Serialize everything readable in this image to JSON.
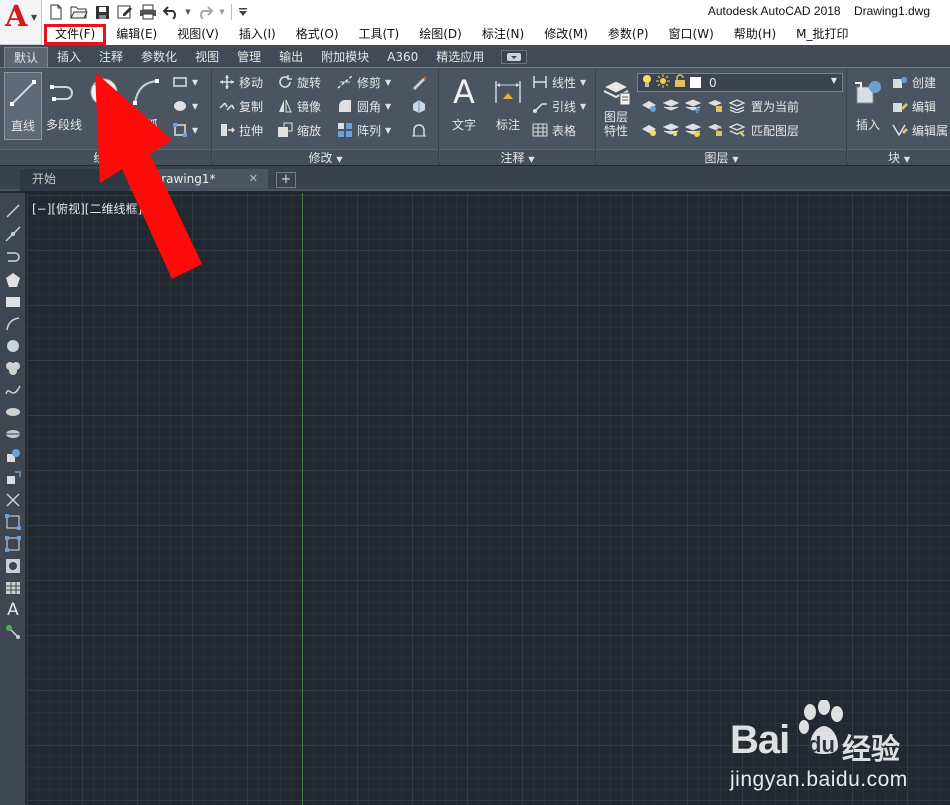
{
  "app": {
    "title": "Autodesk AutoCAD 2018",
    "document": "Drawing1.dwg",
    "logo_letter": "A"
  },
  "menu": [
    "文件(F)",
    "编辑(E)",
    "视图(V)",
    "插入(I)",
    "格式(O)",
    "工具(T)",
    "绘图(D)",
    "标注(N)",
    "修改(M)",
    "参数(P)",
    "窗口(W)",
    "帮助(H)",
    "M_批打印"
  ],
  "ribbon_tabs": [
    "默认",
    "插入",
    "注释",
    "参数化",
    "视图",
    "管理",
    "输出",
    "附加模块",
    "A360",
    "精选应用"
  ],
  "panels": {
    "draw": {
      "title": "绘图",
      "line": "直线",
      "polyline": "多段线",
      "arc": "圆弧"
    },
    "modify": {
      "title": "修改",
      "move": "移动",
      "rotate": "旋转",
      "trim": "修剪",
      "copy": "复制",
      "mirror": "镜像",
      "fillet": "圆角",
      "stretch": "拉伸",
      "scale": "缩放",
      "array": "阵列"
    },
    "annotation": {
      "title": "注释",
      "text": "文字",
      "dimension": "标注",
      "linear": "线性",
      "leader": "引线",
      "table": "表格"
    },
    "layers": {
      "title": "图层",
      "properties_line1": "图层",
      "properties_line2": "特性",
      "current_layer": "0",
      "set_current": "置为当前",
      "match_layer": "匹配图层"
    },
    "block": {
      "title": "块",
      "insert": "插入",
      "create": "创建",
      "edit": "编辑",
      "edit_attributes": "编辑属"
    }
  },
  "doc_tabs": {
    "start": "开始",
    "active": "Drawing1*"
  },
  "viewport_label": "[−][俯视][二维线框]",
  "watermark": {
    "brand": "Bai",
    "brand_du": "du",
    "brand_cn": "经验",
    "url": "jingyan.baidu.com"
  },
  "colors": {
    "highlight_box": "#e8121d",
    "arrow": "#ff0a0a",
    "canvas": "#212830",
    "ribbon": "#4b5562",
    "y_axis": "#3f7a45"
  }
}
